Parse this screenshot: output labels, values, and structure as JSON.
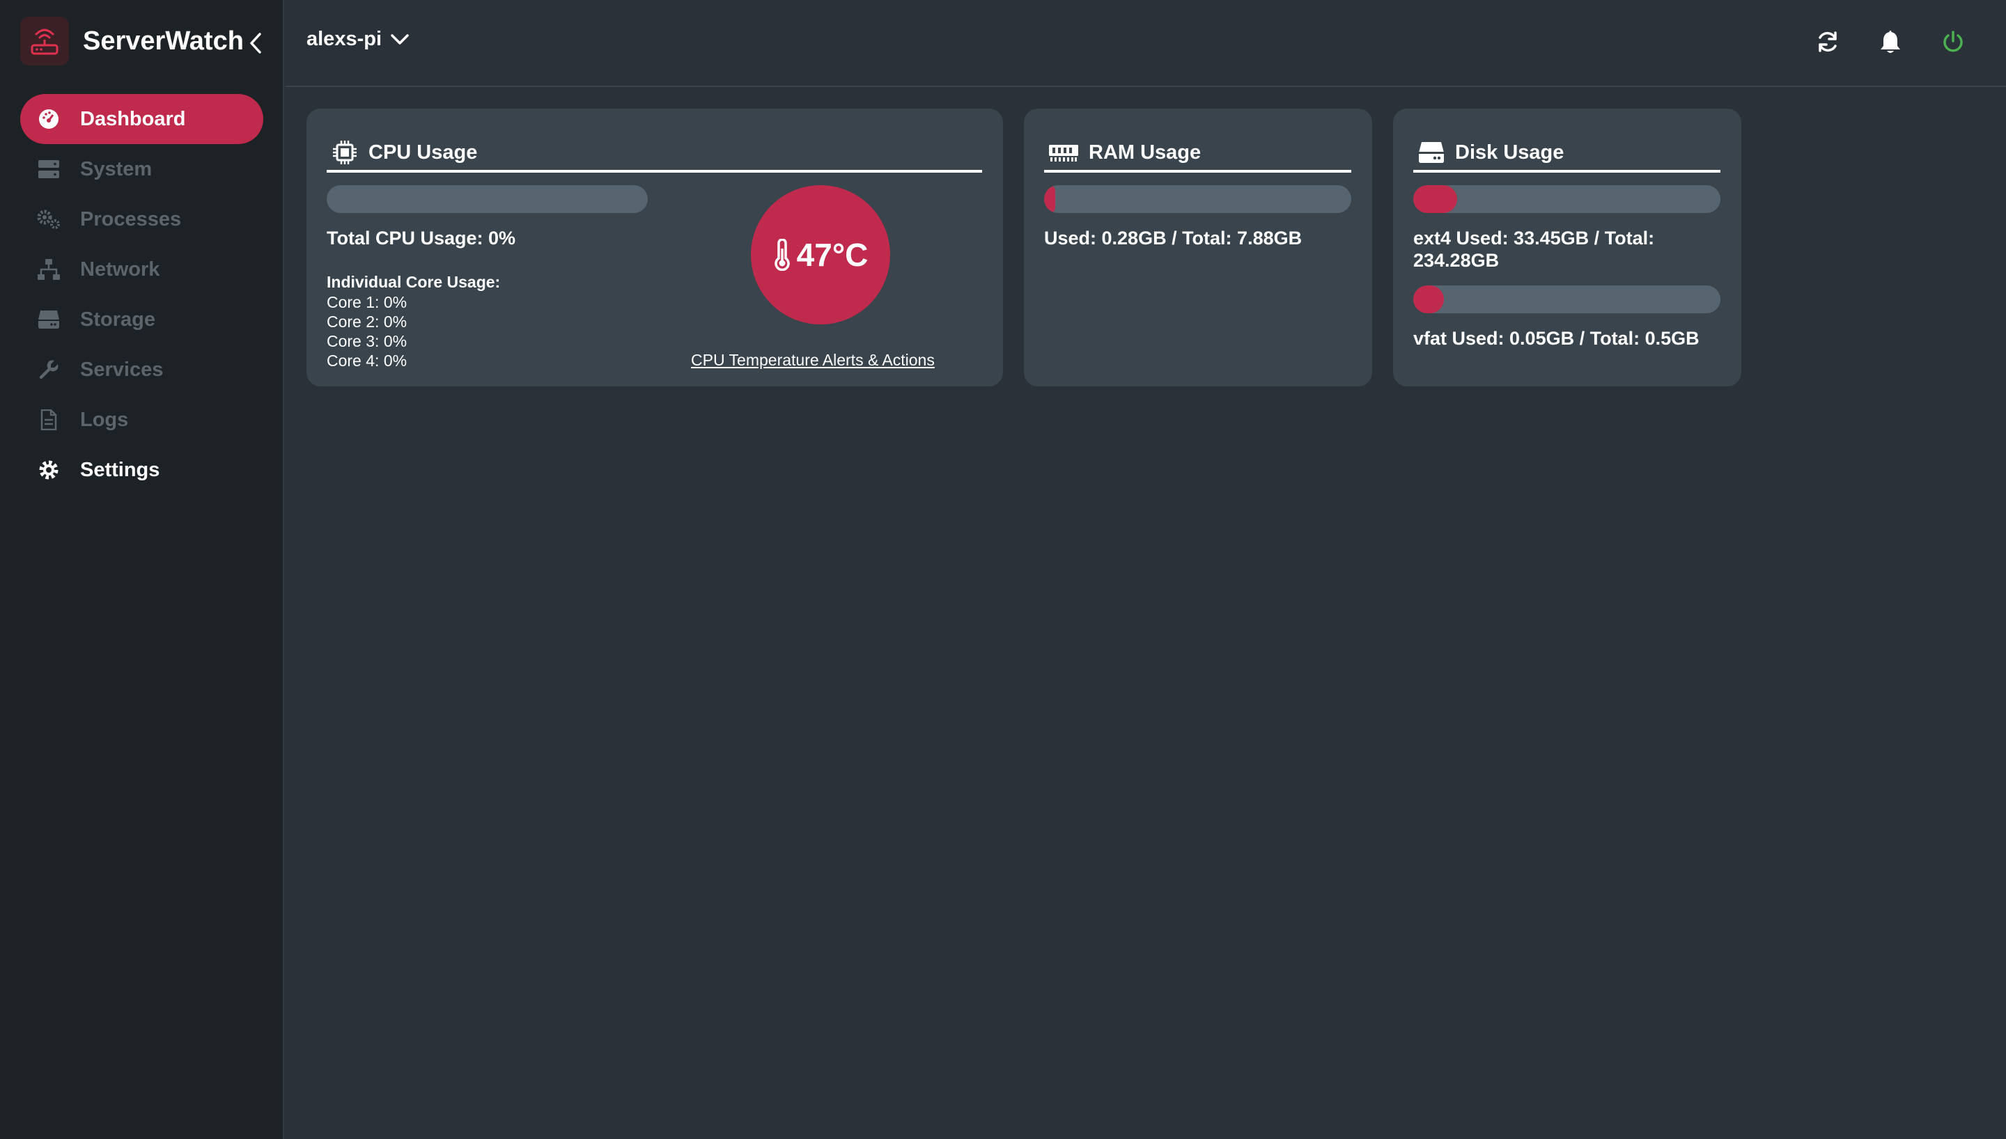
{
  "app": {
    "title": "ServerWatch"
  },
  "sidebar": {
    "items": [
      {
        "label": "Dashboard",
        "icon": "dashboard-icon",
        "active": true
      },
      {
        "label": "System",
        "icon": "server-icon"
      },
      {
        "label": "Processes",
        "icon": "gears-icon"
      },
      {
        "label": "Network",
        "icon": "network-icon"
      },
      {
        "label": "Storage",
        "icon": "hdd-icon"
      },
      {
        "label": "Services",
        "icon": "wrench-icon"
      },
      {
        "label": "Logs",
        "icon": "file-icon"
      },
      {
        "label": "Settings",
        "icon": "gear-icon"
      }
    ]
  },
  "topbar": {
    "host": "alexs-pi",
    "icons": [
      "refresh-icon",
      "bell-icon",
      "power-icon"
    ]
  },
  "colors": {
    "accent": "#c02a4c",
    "power": "#4caf50",
    "track": "#56656f",
    "card": "#39444d"
  },
  "cpu": {
    "title": "CPU Usage",
    "usage_fraction": 0.0,
    "total_label": "Total CPU Usage: 0%",
    "cores_title": "Individual Core Usage:",
    "cores": [
      "Core 1: 0%",
      "Core 2: 0%",
      "Core 3: 0%",
      "Core 4: 0%"
    ],
    "temperature": "47°C",
    "alerts_link": "CPU Temperature Alerts & Actions"
  },
  "ram": {
    "title": "RAM Usage",
    "usage_fraction": 0.036,
    "label": "Used: 0.28GB / Total: 7.88GB"
  },
  "disk": {
    "title": "Disk Usage",
    "ext4": {
      "usage_fraction": 0.143,
      "label_line1": "ext4 Used: 33.45GB / Total:",
      "label_line2": "234.28GB"
    },
    "vfat": {
      "usage_fraction": 0.1,
      "label": "vfat Used: 0.05GB / Total: 0.5GB"
    }
  }
}
